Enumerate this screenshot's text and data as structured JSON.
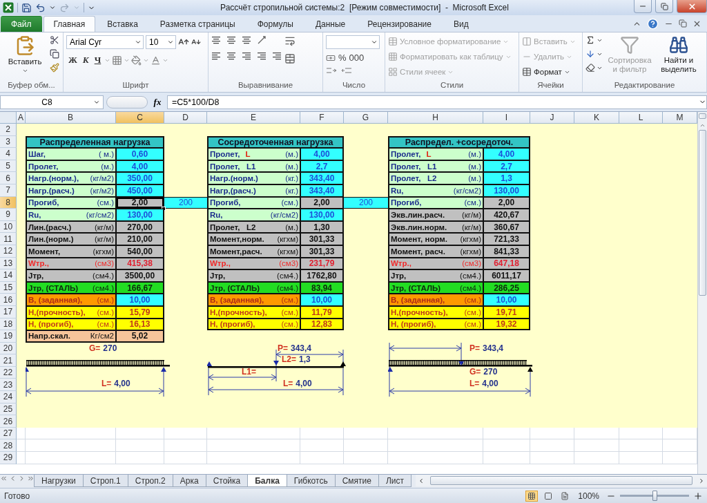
{
  "window": {
    "title": "Рассчёт стропильной системы:2  [Режим совместимости]  -  Microsoft Excel"
  },
  "ribbon_tabs": [
    {
      "label": "Файл",
      "kind": "file",
      "selected": false
    },
    {
      "label": "Главная",
      "kind": "tab",
      "selected": true
    },
    {
      "label": "Вставка",
      "kind": "tab",
      "selected": false
    },
    {
      "label": "Разметка страницы",
      "kind": "tab",
      "selected": false
    },
    {
      "label": "Формулы",
      "kind": "tab",
      "selected": false
    },
    {
      "label": "Данные",
      "kind": "tab",
      "selected": false
    },
    {
      "label": "Рецензирование",
      "kind": "tab",
      "selected": false
    },
    {
      "label": "Вид",
      "kind": "tab",
      "selected": false
    }
  ],
  "ribbon": {
    "clipboard": {
      "paste": "Вставить",
      "caption": "Буфер обм..."
    },
    "font": {
      "name": "Arial Cyr",
      "size": "10",
      "bold": "Ж",
      "italic": "К",
      "underline": "Ч",
      "caption": "Шрифт"
    },
    "alignment": {
      "caption": "Выравнивание"
    },
    "number": {
      "percent": "%",
      "thousands": "000",
      "caption": "Число"
    },
    "styles": {
      "items": [
        {
          "label": "Условное форматирование",
          "disabled": true
        },
        {
          "label": "Форматировать как таблицу",
          "disabled": true
        },
        {
          "label": "Стили ячеек",
          "disabled": true
        }
      ],
      "caption": "Стили"
    },
    "cells": {
      "items": [
        {
          "label": "Вставить",
          "disabled": true
        },
        {
          "label": "Удалить",
          "disabled": true
        },
        {
          "label": "Формат",
          "disabled": false
        }
      ],
      "caption": "Ячейки"
    },
    "editing": {
      "items": [
        {
          "label": "Сортировка и фильтр",
          "disabled": true
        },
        {
          "label": "Найти и выделить",
          "disabled": false
        }
      ],
      "caption": "Редактирование"
    }
  },
  "formula_bar": {
    "name_box": "C8",
    "function_symbol": "fx",
    "formula": "=C5*100/D8"
  },
  "columns": [
    {
      "label": "A",
      "selected": false
    },
    {
      "label": "B",
      "selected": false
    },
    {
      "label": "C",
      "selected": true
    },
    {
      "label": "D",
      "selected": false
    },
    {
      "label": "E",
      "selected": false
    },
    {
      "label": "F",
      "selected": false
    },
    {
      "label": "G",
      "selected": false
    },
    {
      "label": "H",
      "selected": false
    },
    {
      "label": "I",
      "selected": false
    },
    {
      "label": "J",
      "selected": false
    },
    {
      "label": "K",
      "selected": false
    },
    {
      "label": "L",
      "selected": false
    },
    {
      "label": "M",
      "selected": false
    }
  ],
  "row_headers": [
    {
      "label": "2",
      "selected": false
    },
    {
      "label": "3",
      "selected": false
    },
    {
      "label": "4",
      "selected": false
    },
    {
      "label": "5",
      "selected": false
    },
    {
      "label": "6",
      "selected": false
    },
    {
      "label": "7",
      "selected": false
    },
    {
      "label": "8",
      "selected": true
    },
    {
      "label": "9",
      "selected": false
    },
    {
      "label": "10",
      "selected": false
    },
    {
      "label": "11",
      "selected": false
    },
    {
      "label": "12",
      "selected": false
    },
    {
      "label": "13",
      "selected": false
    },
    {
      "label": "14",
      "selected": false
    },
    {
      "label": "15",
      "selected": false
    },
    {
      "label": "16",
      "selected": false
    },
    {
      "label": "17",
      "selected": false
    },
    {
      "label": "18",
      "selected": false
    },
    {
      "label": "19",
      "selected": false
    },
    {
      "label": "20",
      "selected": false
    },
    {
      "label": "21",
      "selected": false
    },
    {
      "label": "22",
      "selected": false
    },
    {
      "label": "23",
      "selected": false
    },
    {
      "label": "24",
      "selected": false
    },
    {
      "label": "25",
      "selected": false
    },
    {
      "label": "26",
      "selected": false
    },
    {
      "label": "27",
      "selected": false
    },
    {
      "label": "28",
      "selected": false
    },
    {
      "label": "29",
      "selected": false
    }
  ],
  "tables": [
    {
      "title": "Распределенная нагрузка",
      "rows": [
        {
          "label": "Шаг,",
          "unit": "( м.)",
          "value": "0,60",
          "kind": "input",
          "selected": false
        },
        {
          "label": "Пролет,",
          "unit": "(м.)",
          "value": "4,00",
          "kind": "input",
          "selected": false
        },
        {
          "label": "Нагр.(норм.),",
          "unit": "(кг/м2)",
          "value": "350,00",
          "kind": "input",
          "selected": false
        },
        {
          "label": "Нагр.(расч.)",
          "unit": "(кг/м2)",
          "value": "450,00",
          "kind": "input",
          "selected": false
        },
        {
          "label": "Прогиб,",
          "unit": "(см.)",
          "value": "2,00",
          "kind": "input_calc",
          "selected": true
        },
        {
          "label": "Ru,",
          "unit": "(кг/см2)",
          "value": "130,00",
          "kind": "input",
          "selected": false
        },
        {
          "label": "Лин.(расч.)",
          "unit": "(кг/м)",
          "value": "270,00",
          "kind": "calc",
          "selected": false
        },
        {
          "label": "Лин.(норм.)",
          "unit": "(кг/м)",
          "value": "210,00",
          "kind": "calc",
          "selected": false
        },
        {
          "label": "Момент,",
          "unit": "(кгхм)",
          "value": "540,00",
          "kind": "calc",
          "selected": false
        },
        {
          "label": "Wтр.,",
          "unit": "(см3)",
          "value": "415,38",
          "kind": "w",
          "selected": false
        },
        {
          "label": "Jтр,",
          "unit": "(см4.)",
          "value": "3500,00",
          "kind": "calc",
          "selected": false
        },
        {
          "label": "Jтр, (СТАЛЬ)",
          "unit": "(см4.)",
          "value": "166,67",
          "kind": "steel",
          "selected": false
        },
        {
          "label": "В, (заданная),",
          "unit": "(см.)",
          "value": "10,00",
          "kind": "given",
          "selected": false
        },
        {
          "label": "Н,(прочность),",
          "unit": "(см.)",
          "value": "15,79",
          "kind": "result",
          "selected": false
        },
        {
          "label": "Н, (прогиб),",
          "unit": "(см.)",
          "value": "16,13",
          "kind": "result",
          "selected": false
        },
        {
          "label": "Напр.скал.",
          "unit": "Кг/см2",
          "value": "5,02",
          "kind": "shear",
          "selected": false
        }
      ]
    },
    {
      "title": "Сосредоточенная нагрузка",
      "rows": [
        {
          "label": "Пролет,",
          "symbol": "L",
          "unit": "(м.)",
          "value": "4,00",
          "kind": "input",
          "selected": false
        },
        {
          "label": "Пролет,   L1",
          "unit": "(м.)",
          "value": "2,7",
          "kind": "input",
          "selected": false
        },
        {
          "label": "Нагр.(норм.)",
          "unit": "(кг.)",
          "value": "343,40",
          "kind": "input",
          "selected": false
        },
        {
          "label": "Нагр,(расч.)",
          "unit": "(кг.)",
          "value": "343,40",
          "kind": "input",
          "selected": false
        },
        {
          "label": "Прогиб,",
          "unit": "(см.)",
          "value": "2,00",
          "kind": "input_calc",
          "selected": false
        },
        {
          "label": "Ru,",
          "unit": "(кг/см2)",
          "value": "130,00",
          "kind": "input",
          "selected": false
        },
        {
          "label": "Пролет,   L2",
          "unit": "(м.)",
          "value": "1,30",
          "kind": "calc",
          "selected": false
        },
        {
          "label": "Момент,норм.",
          "unit": "(кгхм)",
          "value": "301,33",
          "kind": "calc",
          "selected": false
        },
        {
          "label": "Момент,расч.",
          "unit": "(кгхм)",
          "value": "301,33",
          "kind": "calc",
          "selected": false
        },
        {
          "label": "Wтр.,",
          "unit": "(см3)",
          "value": "231,79",
          "kind": "w",
          "selected": false
        },
        {
          "label": "Jтр,",
          "unit": "(см4.)",
          "value": "1762,80",
          "kind": "calc",
          "selected": false
        },
        {
          "label": "Jтр, (СТАЛЬ)",
          "unit": "(см4.)",
          "value": "83,94",
          "kind": "steel",
          "selected": false
        },
        {
          "label": "В, (заданная),",
          "unit": "(см.)",
          "value": "10,00",
          "kind": "given",
          "selected": false
        },
        {
          "label": "Н,(прочность),",
          "unit": "(см.)",
          "value": "11,79",
          "kind": "result",
          "selected": false
        },
        {
          "label": "Н, (прогиб),",
          "unit": "(см.)",
          "value": "12,83",
          "kind": "result",
          "selected": false
        }
      ]
    },
    {
      "title": "Распредел. +сосредоточ.",
      "rows": [
        {
          "label": "Пролет,",
          "symbol": "L",
          "unit": "(м.)",
          "value": "4,00",
          "kind": "input",
          "selected": false
        },
        {
          "label": "Пролет,   L1",
          "unit": "(м.)",
          "value": "2,7",
          "kind": "input",
          "selected": false
        },
        {
          "label": "Пролет,   L2",
          "unit": "(м.)",
          "value": "1,3",
          "kind": "input",
          "selected": false
        },
        {
          "label": "Ru,",
          "unit": "(кг/см2)",
          "value": "130,00",
          "kind": "input",
          "selected": false
        },
        {
          "label": "Прогиб,",
          "unit": "(см.)",
          "value": "2,00",
          "kind": "input_calc",
          "selected": false
        },
        {
          "label": "Экв.лин.расч.",
          "unit": "(кг/м)",
          "value": "420,67",
          "kind": "calc",
          "selected": false
        },
        {
          "label": "Экв.лин.норм.",
          "unit": "(кг/м)",
          "value": "360,67",
          "kind": "calc",
          "selected": false
        },
        {
          "label": "Момент, норм.",
          "unit": "(кгхм)",
          "value": "721,33",
          "kind": "calc",
          "selected": false
        },
        {
          "label": "Момент, расч.",
          "unit": "(кгхм)",
          "value": "841,33",
          "kind": "calc",
          "selected": false
        },
        {
          "label": "Wтр.,",
          "unit": "(см3)",
          "value": "647,18",
          "kind": "w",
          "selected": false
        },
        {
          "label": "Jтр,",
          "unit": "(см4.)",
          "value": "6011,17",
          "kind": "calc",
          "selected": false
        },
        {
          "label": "Jтр, (СТАЛЬ)",
          "unit": "(см4.)",
          "value": "286,25",
          "kind": "steel",
          "selected": false
        },
        {
          "label": "В, (заданная),",
          "unit": "(см.)",
          "value": "10,00",
          "kind": "given",
          "selected": false
        },
        {
          "label": "Н,(прочность),",
          "unit": "(см.)",
          "value": "19,71",
          "kind": "result",
          "selected": false
        },
        {
          "label": "Н, (прогиб),",
          "unit": "(см.)",
          "value": "19,32",
          "kind": "result",
          "selected": false
        }
      ]
    }
  ],
  "links": [
    {
      "value": "200",
      "selected": false
    },
    {
      "value": "200",
      "selected": false
    }
  ],
  "diagrams": [
    {
      "kind": "uniform",
      "texts": [
        {
          "label": "G=",
          "value": "270"
        },
        {
          "label": "L=",
          "value": "4,00"
        }
      ]
    },
    {
      "kind": "point",
      "texts": [
        {
          "label": "P=",
          "value": "343,4"
        },
        {
          "label": "L2=",
          "value": "1,3"
        },
        {
          "label": "L1="
        },
        {
          "label": "L=",
          "value": "4,00"
        }
      ]
    },
    {
      "kind": "combined",
      "texts": [
        {
          "label": "P=",
          "value": "343,4"
        },
        {
          "label": "G=",
          "value": "270"
        },
        {
          "label": "L=",
          "value": "4,00"
        }
      ]
    }
  ],
  "sheet_tabs": [
    {
      "label": "Нагрузки",
      "selected": false
    },
    {
      "label": "Строп.1",
      "selected": false
    },
    {
      "label": "Строп.2",
      "selected": false
    },
    {
      "label": "Арка",
      "selected": false
    },
    {
      "label": "Стойка",
      "selected": false
    },
    {
      "label": "Балка",
      "selected": true
    },
    {
      "label": "Гибкотсь",
      "selected": false
    },
    {
      "label": "Смятие",
      "selected": false
    },
    {
      "label": "Лист",
      "selected": false
    }
  ],
  "status_bar": {
    "status": "Готово",
    "views": [
      {
        "kind": "normal",
        "selected": true
      },
      {
        "kind": "layout",
        "selected": false
      },
      {
        "kind": "pagebreak",
        "selected": false
      }
    ],
    "zoom": {
      "label": "100%",
      "level": 0.5
    }
  }
}
